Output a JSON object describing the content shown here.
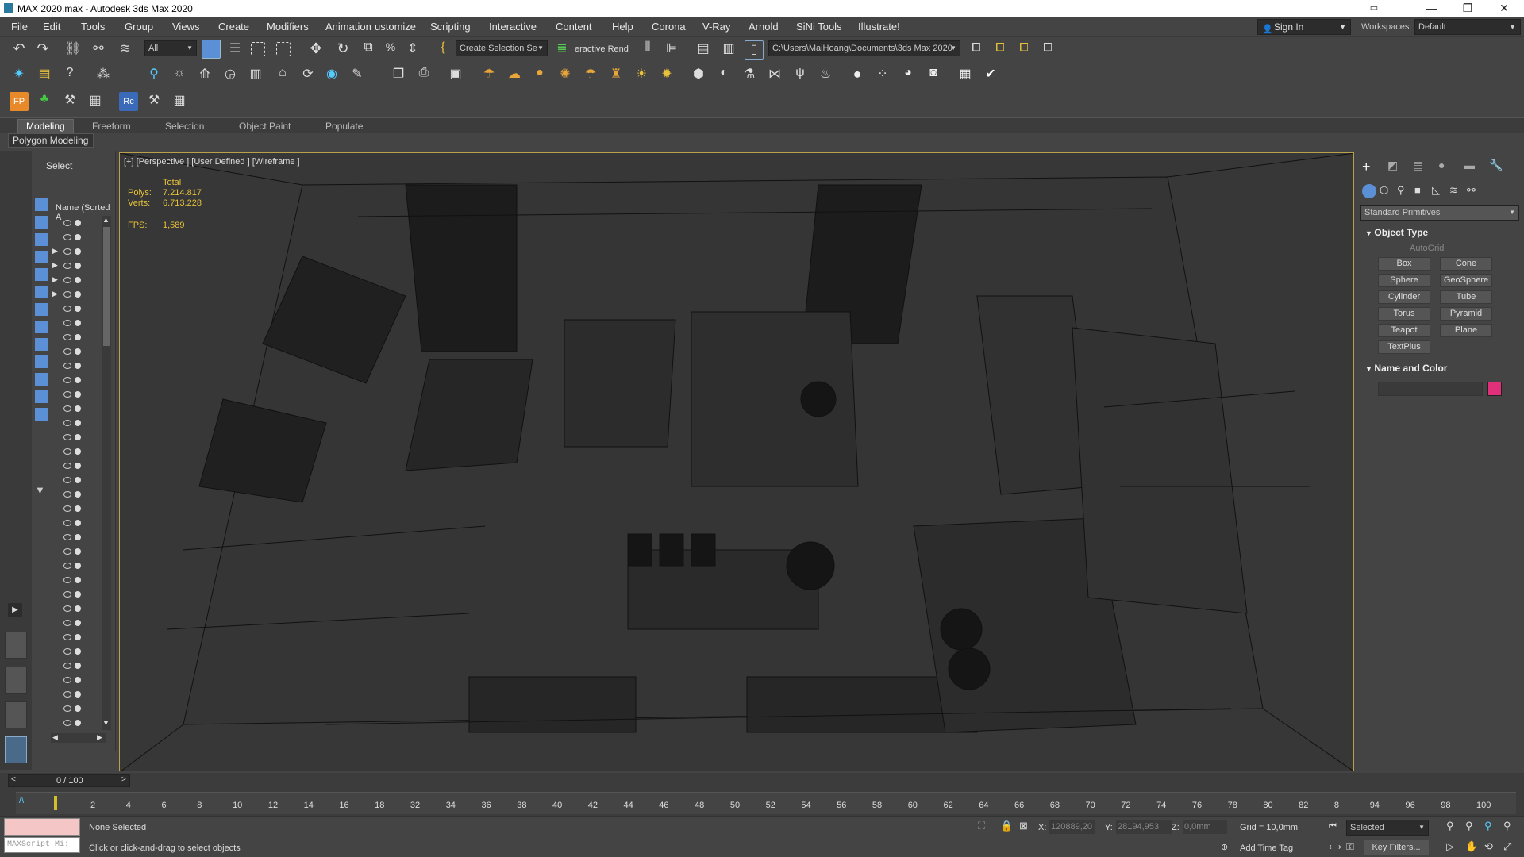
{
  "window": {
    "title": "MAX 2020.max - Autodesk 3ds Max 2020",
    "minimize": "—",
    "maximize": "❐",
    "close": "✕"
  },
  "menu": [
    "File",
    "Edit",
    "Tools",
    "Group",
    "Views",
    "Create",
    "Modifiers",
    "Animation",
    "ustomize",
    "Scripting",
    "Interactive",
    "Content",
    "Help",
    "Corona",
    "V-Ray",
    "Arnold",
    "SiNi Tools",
    "Illustrate!"
  ],
  "signin": "Sign In",
  "workspaces": {
    "label": "Workspaces:",
    "value": "Default"
  },
  "toolbar": {
    "filter": "All",
    "named_selection": "Create Selection Se",
    "interactive": "eractive Rend",
    "path": "C:\\Users\\MaiHoang\\Documents\\3ds Max 2020"
  },
  "ribbon": {
    "tabs": [
      "Modeling",
      "Freeform",
      "Selection",
      "Object Paint",
      "Populate"
    ],
    "active": "Modeling",
    "panel": "Polygon Modeling"
  },
  "scene_explorer": {
    "title": "Select",
    "column": "Name (Sorted A"
  },
  "viewport": {
    "label": "[+] [Perspective ] [User Defined ] [Wireframe ]",
    "stats": {
      "total": "Total",
      "polys_label": "Polys:",
      "polys": "7.214.817",
      "verts_label": "Verts:",
      "verts": "6.713.228",
      "fps_label": "FPS:",
      "fps": "1,589"
    }
  },
  "command_panel": {
    "category": "Standard Primitives",
    "object_type": "Object Type",
    "autogrid": "AutoGrid",
    "buttons": [
      "Box",
      "Cone",
      "Sphere",
      "GeoSphere",
      "Cylinder",
      "Tube",
      "Torus",
      "Pyramid",
      "Teapot",
      "Plane",
      "TextPlus"
    ],
    "name_and_color": "Name and Color",
    "color": "#e0307a"
  },
  "timeline": {
    "frame": "0 / 100",
    "ticks": [
      "2",
      "4",
      "6",
      "8",
      "10",
      "12",
      "14",
      "16",
      "18",
      "32",
      "34",
      "36",
      "38",
      "40",
      "42",
      "44",
      "46",
      "48",
      "50",
      "52",
      "54",
      "56",
      "58",
      "60",
      "62",
      "64",
      "66",
      "68",
      "70",
      "72",
      "74",
      "76",
      "78",
      "80",
      "82",
      "8",
      "94",
      "96",
      "98",
      "100"
    ]
  },
  "status": {
    "maxscript": "MAXScript Mi:",
    "selection": "None Selected",
    "prompt": "Click or click-and-drag to select objects",
    "x_label": "X:",
    "x": "120889,20",
    "y_label": "Y:",
    "y": "28194,953",
    "z_label": "Z:",
    "z": "0,0mm",
    "grid": "Grid = 10,0mm",
    "add_time_tag": "Add Time Tag",
    "selected": "Selected",
    "key_filters": "Key Filters..."
  }
}
